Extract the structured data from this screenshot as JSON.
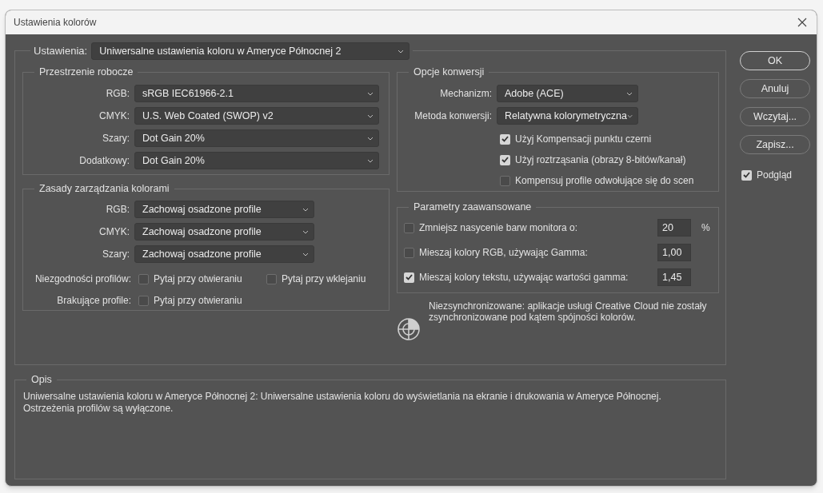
{
  "window": {
    "title": "Ustawienia kolorów"
  },
  "settings": {
    "label": "Ustawienia:",
    "value": "Uniwersalne ustawienia koloru w Ameryce Północnej 2"
  },
  "working_spaces": {
    "title": "Przestrzenie robocze",
    "fields": [
      {
        "label": "RGB:",
        "value": "sRGB IEC61966-2.1"
      },
      {
        "label": "CMYK:",
        "value": "U.S. Web Coated (SWOP) v2"
      },
      {
        "label": "Szary:",
        "value": "Dot Gain 20%"
      },
      {
        "label": "Dodatkowy:",
        "value": "Dot Gain 20%"
      }
    ]
  },
  "policies": {
    "title": "Zasady zarządzania kolorami",
    "fields": [
      {
        "label": "RGB:",
        "value": "Zachowaj osadzone profile"
      },
      {
        "label": "CMYK:",
        "value": "Zachowaj osadzone profile"
      },
      {
        "label": "Szary:",
        "value": "Zachowaj osadzone profile"
      }
    ],
    "checks": [
      {
        "label": "Niezgodności profilów:",
        "options": [
          {
            "label": "Pytaj przy otwieraniu",
            "checked": false
          },
          {
            "label": "Pytaj przy wklejaniu",
            "checked": false
          }
        ]
      },
      {
        "label": "Brakujące profile:",
        "options": [
          {
            "label": "Pytaj przy otwieraniu",
            "checked": false
          }
        ]
      }
    ]
  },
  "conversion": {
    "title": "Opcje konwersji",
    "fields": [
      {
        "label": "Mechanizm:",
        "value": "Adobe (ACE)"
      },
      {
        "label": "Metoda konwersji:",
        "value": "Relatywna kolorymetryczna"
      }
    ],
    "options": [
      {
        "label": "Użyj Kompensacji punktu czerni",
        "checked": true
      },
      {
        "label": "Użyj roztrząsania (obrazy 8-bitów/kanał)",
        "checked": true
      },
      {
        "label": "Kompensuj profile odwołujące się do scen",
        "checked": false
      }
    ]
  },
  "advanced": {
    "title": "Parametry zaawansowane",
    "rows": [
      {
        "label": "Zmniejsz nasycenie barw monitora o:",
        "checked": false,
        "value": "20",
        "unit": "%"
      },
      {
        "label": "Mieszaj kolory RGB, używając Gamma:",
        "checked": false,
        "value": "1,00"
      },
      {
        "label": "Mieszaj kolory tekstu, używając wartości gamma:",
        "checked": true,
        "value": "1,45"
      }
    ]
  },
  "sync": {
    "message": "Niezsynchronizowane: aplikacje usługi Creative Cloud nie zostały zsynchronizowane pod kątem spójności kolorów."
  },
  "description": {
    "title": "Opis",
    "text": "Uniwersalne ustawienia koloru w Ameryce Północnej 2:  Uniwersalne ustawienia koloru do wyświetlania na ekranie i drukowania w Ameryce Północnej. Ostrzeżenia profilów są wyłączone."
  },
  "buttons": [
    {
      "label": "OK",
      "default": true
    },
    {
      "label": "Anuluj",
      "default": false
    },
    {
      "label": "Wczytaj...",
      "default": false
    },
    {
      "label": "Zapisz...",
      "default": false
    }
  ],
  "preview": {
    "label": "Podgląd",
    "checked": true
  }
}
